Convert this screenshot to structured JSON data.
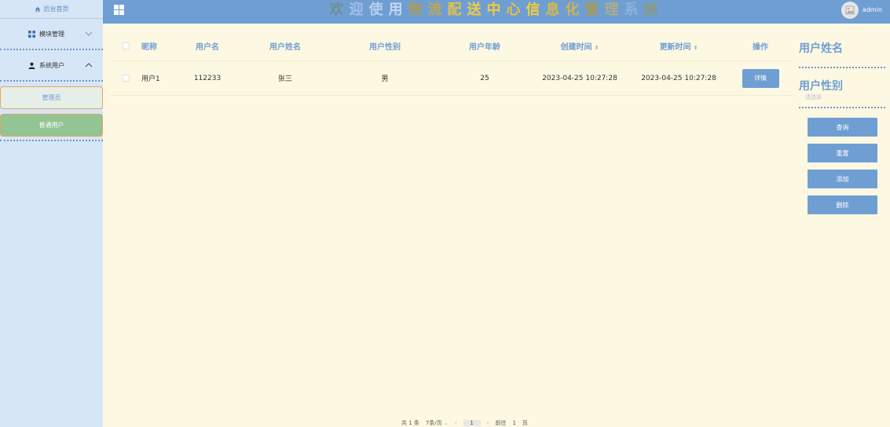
{
  "sidebar": {
    "home": "后台首页",
    "groups": [
      {
        "label": "模块管理"
      },
      {
        "label": "系统用户"
      }
    ],
    "sub_items": [
      "管理员",
      "普通用户"
    ]
  },
  "header": {
    "title_chars": [
      "欢",
      "迎",
      "使",
      "用",
      "物",
      "流",
      "配",
      "送",
      "中",
      "心",
      "信",
      "息",
      "化",
      "管",
      "理",
      "系",
      "统"
    ],
    "title_colors": [
      "#6e8f95",
      "#a4c0e7",
      "#b7d0ec",
      "#c4d6ef",
      "#aa9c56",
      "#c4a64e",
      "#e3c04a",
      "#f0cb43",
      "#f5cb3a",
      "#e7c240",
      "#f3cf3f",
      "#d8b94b",
      "#d0b34d",
      "#a99a56",
      "#b1ac82",
      "#8fb3db",
      "#8b9a7c"
    ],
    "username": "admin"
  },
  "table": {
    "headers": [
      "昵称",
      "用户名",
      "用户姓名",
      "用户性别",
      "用户年龄",
      "创建时间",
      "更新时间",
      "操作"
    ],
    "rows": [
      {
        "nickname": "用户1",
        "username": "112233",
        "realname": "张三",
        "gender": "男",
        "age": "25",
        "created": "2023-04-25 10:27:28",
        "updated": "2023-04-25 10:27:28",
        "action": "详情"
      }
    ]
  },
  "panel": {
    "field1": "用户姓名",
    "field2": "用户性别",
    "select_placeholder": "请选择",
    "buttons": [
      "查询",
      "重置",
      "添加",
      "删除"
    ]
  },
  "pagination": {
    "total": "共 1 条",
    "page_size": "7条/页",
    "current_page": "1",
    "goto_label": "前往",
    "goto_value": "1",
    "page_suffix": "页"
  },
  "colors": {
    "accent": "#6f9ed3",
    "sidebar_bg": "#d6e6f6",
    "main_bg": "#fdf8e2",
    "active_item": "#93c493",
    "border_orange": "#e7a45b"
  }
}
